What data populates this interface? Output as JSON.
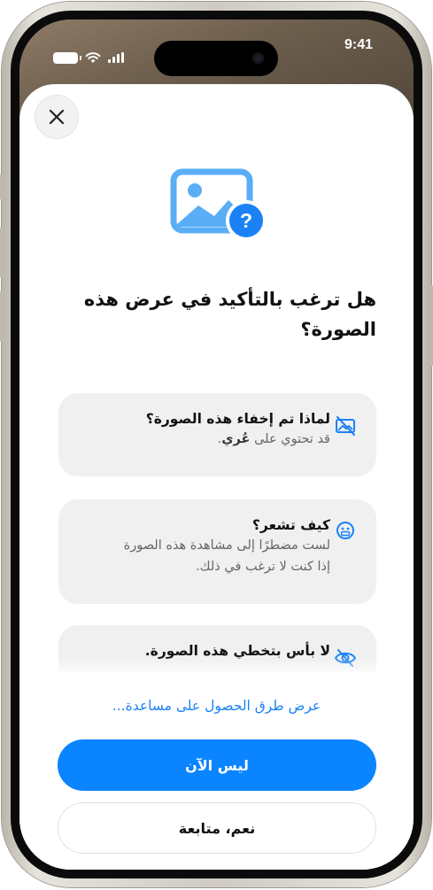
{
  "status_bar": {
    "time": "9:41"
  },
  "dialog": {
    "close_icon": "close-icon",
    "hero_icon": "photo-question-icon",
    "title": "هل ترغب بالتأكيد في عرض هذه الصورة؟",
    "cards": [
      {
        "icon": "hidden-photo-icon",
        "heading": "لماذا تم إخفاء هذه الصورة؟",
        "body_prefix": "قد تحتوي على ",
        "body_bold": "عُري",
        "body_suffix": "."
      },
      {
        "icon": "face-icon",
        "heading": "كيف تشعر؟",
        "body": "لست مضطرًا إلى مشاهدة هذه الصورة إذا كنت لا ترغب في ذلك."
      },
      {
        "icon": "eye-slash-icon",
        "heading": "لا بأس بتخطي هذه الصورة."
      }
    ],
    "help_link": "عرض طرق الحصول على مساعدة...",
    "primary_button": "ليس الآن",
    "secondary_button": "نعم، متابعة"
  },
  "colors": {
    "accent": "#0A84FF",
    "link": "#1A82F5",
    "card_bg": "#F0F0F0",
    "icon_blue": "#1A82F5"
  }
}
